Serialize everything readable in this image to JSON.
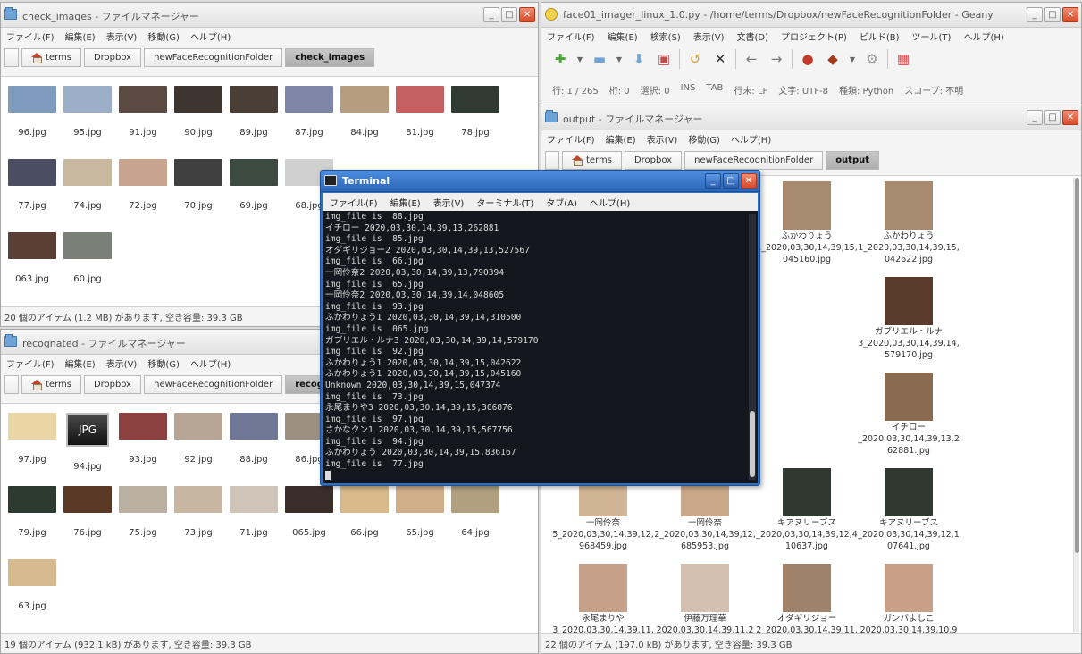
{
  "check_images": {
    "title": "check_images - ファイルマネージャー",
    "menu": [
      "ファイル(F)",
      "編集(E)",
      "表示(V)",
      "移動(G)",
      "ヘルプ(H)"
    ],
    "breadcrumb": [
      "terms",
      "Dropbox",
      "newFaceRecognitionFolder",
      "check_images"
    ],
    "files": [
      {
        "name": "96.jpg",
        "color": "#7f9cbf"
      },
      {
        "name": "95.jpg",
        "color": "#9bb0c8"
      },
      {
        "name": "91.jpg",
        "color": "#5a4a42"
      },
      {
        "name": "90.jpg",
        "color": "#3d3530"
      },
      {
        "name": "89.jpg",
        "color": "#4a3e36"
      },
      {
        "name": "87.jpg",
        "color": "#7e86a8"
      },
      {
        "name": "84.jpg",
        "color": "#b79d80"
      },
      {
        "name": "81.jpg",
        "color": "#c65f5f"
      },
      {
        "name": "78.jpg",
        "color": "#2f3a34"
      },
      {
        "name": "77.jpg",
        "color": "#4b4e63"
      },
      {
        "name": "74.jpg",
        "color": "#c9b8a0"
      },
      {
        "name": "72.jpg",
        "color": "#c8a48e"
      },
      {
        "name": "70.jpg",
        "color": "#3f3f3f"
      },
      {
        "name": "69.jpg",
        "color": "#3c4a40"
      },
      {
        "name": "68.jpg",
        "color": "#d0d0d0"
      },
      {
        "name": "",
        "color": "#ffffff"
      },
      {
        "name": "",
        "color": "#ffffff"
      },
      {
        "name": "",
        "color": "#ffffff"
      },
      {
        "name": "063.jpg",
        "color": "#5a3f36"
      },
      {
        "name": "60.jpg",
        "color": "#7a8078"
      }
    ],
    "status": "20 個のアイテム (1.2 MB) があります, 空き容量: 39.3 GB"
  },
  "recognated": {
    "title": "recognated - ファイルマネージャー",
    "menu": [
      "ファイル(F)",
      "編集(E)",
      "表示(V)",
      "移動(G)",
      "ヘルプ(H)"
    ],
    "breadcrumb": [
      "terms",
      "Dropbox",
      "newFaceRecognitionFolder",
      "recognated"
    ],
    "jpg_label": "JPG",
    "files": [
      {
        "name": "97.jpg",
        "color": "#e9d6a6"
      },
      {
        "name": "94.jpg",
        "color": "jpg"
      },
      {
        "name": "93.jpg",
        "color": "#8c4040"
      },
      {
        "name": "92.jpg",
        "color": "#b7a595"
      },
      {
        "name": "88.jpg",
        "color": "#6f7796"
      },
      {
        "name": "86.jpg",
        "color": "#9e9080"
      },
      {
        "name": "",
        "color": "#ffffff"
      },
      {
        "name": "",
        "color": "#ffffff"
      },
      {
        "name": "",
        "color": "#ffffff"
      },
      {
        "name": "79.jpg",
        "color": "#2c3a30"
      },
      {
        "name": "76.jpg",
        "color": "#5a3a26"
      },
      {
        "name": "75.jpg",
        "color": "#b9b0a2"
      },
      {
        "name": "73.jpg",
        "color": "#c7b6a2"
      },
      {
        "name": "71.jpg",
        "color": "#cfc4b8"
      },
      {
        "name": "065.jpg",
        "color": "#3a2e2a"
      },
      {
        "name": "66.jpg",
        "color": "#d7b98a"
      },
      {
        "name": "65.jpg",
        "color": "#cfae8a"
      },
      {
        "name": "64.jpg",
        "color": "#b0a080"
      },
      {
        "name": "63.jpg",
        "color": "#d6b98e"
      }
    ],
    "status": "19 個のアイテム (932.1 kB) があります, 空き容量: 39.3 GB"
  },
  "geany": {
    "title": "face01_imager_linux_1.0.py - /home/terms/Dropbox/newFaceRecognitionFolder - Geany",
    "menu": [
      "ファイル(F)",
      "編集(E)",
      "検索(S)",
      "表示(V)",
      "文書(D)",
      "プロジェクト(P)",
      "ビルド(B)",
      "ツール(T)",
      "ヘルプ(H)"
    ],
    "info": [
      "行: 1 / 265",
      "桁: 0",
      "選択: 0",
      "INS",
      "TAB",
      "行末: LF",
      "文字: UTF-8",
      "種類: Python",
      "スコープ: 不明"
    ]
  },
  "output": {
    "title": "output - ファイルマネージャー",
    "menu": [
      "ファイル(F)",
      "編集(E)",
      "表示(V)",
      "移動(G)",
      "ヘルプ(H)"
    ],
    "breadcrumb": [
      "terms",
      "Dropbox",
      "newFaceRecognitionFolder",
      "output"
    ],
    "files": [
      {
        "name": "",
        "color": "#ffffff"
      },
      {
        "name": "",
        "color": "#ffffff"
      },
      {
        "name": "ふかわりょう\n1_2020,03,30,14,39,15,\n045160.jpg",
        "color": "#a88a70"
      },
      {
        "name": "ふかわりょう\n1_2020,03,30,14,39,15,\n042622.jpg",
        "color": "#a88a70"
      },
      {
        "name": "",
        "color": "#ffffff"
      },
      {
        "name": "一岡伶奈\n2_2020,03,30,14,39,14,\n048605.jpg",
        "color": "#c89a78"
      },
      {
        "name": "",
        "color": "#ffffff"
      },
      {
        "name": "ガブリエル・ルナ\n3_2020,03,30,14,39,14,\n579170.jpg",
        "color": "#5a3a2a"
      },
      {
        "name": "",
        "color": "#ffffff"
      },
      {
        "name": "オダギリジョー\n2_2020,03,30,14,39,13,\n527567.jpg",
        "color": "#a0826a"
      },
      {
        "name": "",
        "color": "#ffffff"
      },
      {
        "name": "イチロー\n_2020,03,30,14,39,13,2\n62881.jpg",
        "color": "#8a6a50"
      },
      {
        "name": "一岡伶奈\n5_2020,03,30,14,39,12,\n968459.jpg",
        "color": "#d0b494"
      },
      {
        "name": "一岡伶奈\n2_2020,03,30,14,39,12,\n685953.jpg",
        "color": "#c8a888"
      },
      {
        "name": "キアヌリーブス\n_2020,03,30,14,39,12,4\n10637.jpg",
        "color": "#2e3a30"
      },
      {
        "name": "キアヌリーブス\n_2020,03,30,14,39,12,1\n07641.jpg",
        "color": "#2e3a30"
      },
      {
        "name": "永尾まりや\n3_2020,03,30,14,39,11,",
        "color": "#c6a088"
      },
      {
        "name": "伊藤万理華\n2020,03,30,14,39,11,2",
        "color": "#d4c0b0"
      },
      {
        "name": "オダギリジョー\n2_2020,03,30,14,39,11,",
        "color": "#a0826a"
      },
      {
        "name": "ガンバよしこ\n2020,03,30,14,39,10,9",
        "color": "#c8a088"
      }
    ],
    "status": "22 個のアイテム (197.0 kB) があります, 空き容量: 39.3 GB"
  },
  "terminal": {
    "title": "Terminal",
    "menu": [
      "ファイル(F)",
      "編集(E)",
      "表示(V)",
      "ターミナル(T)",
      "タブ(A)",
      "ヘルプ(H)"
    ],
    "lines": [
      "img_file is  88.jpg",
      "イチロー 2020,03,30,14,39,13,262881",
      "img_file is  85.jpg",
      "オダギリジョー2 2020,03,30,14,39,13,527567",
      "img_file is  66.jpg",
      "一岡伶奈2 2020,03,30,14,39,13,790394",
      "img_file is  65.jpg",
      "一岡伶奈2 2020,03,30,14,39,14,048605",
      "img_file is  93.jpg",
      "ふかわりょう1 2020,03,30,14,39,14,310500",
      "img_file is  065.jpg",
      "ガブリエル・ルナ3 2020,03,30,14,39,14,579170",
      "img_file is  92.jpg",
      "ふかわりょう1 2020,03,30,14,39,15,042622",
      "ふかわりょう1 2020,03,30,14,39,15,045160",
      "Unknown 2020,03,30,14,39,15,047374",
      "img_file is  73.jpg",
      "永尾まりや3 2020,03,30,14,39,15,306876",
      "img_file is  97.jpg",
      "さかなクン1 2020,03,30,14,39,15,567756",
      "img_file is  94.jpg",
      "ふかわりょう 2020,03,30,14,39,15,836167",
      "img_file is  77.jpg"
    ]
  }
}
